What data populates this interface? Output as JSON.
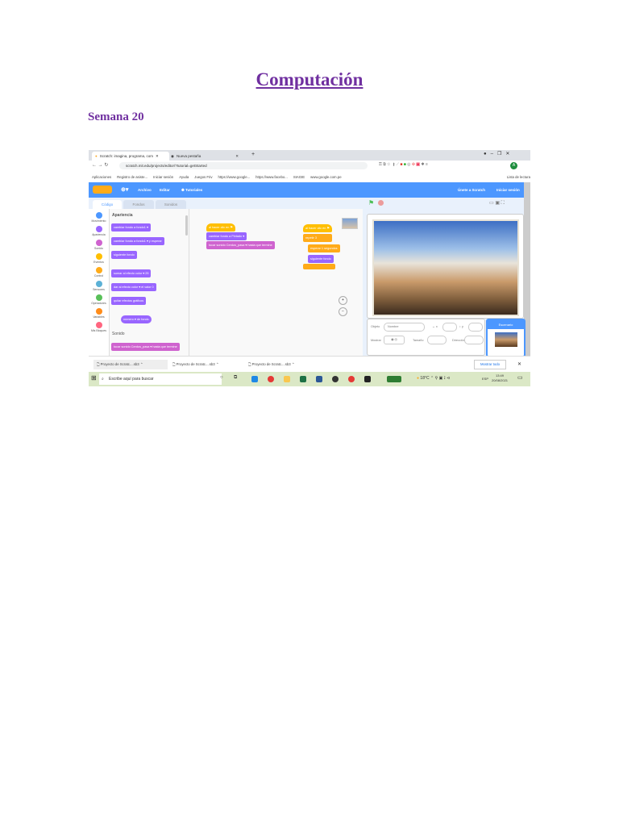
{
  "document": {
    "title": "Computación",
    "week": "Semana 20"
  },
  "browser": {
    "tabs": [
      {
        "label": "Scratch: imagina, programa, com"
      },
      {
        "label": "Nueva pestaña"
      }
    ],
    "url": "scratch.mit.edu/projects/editor/?tutorial=getStarted",
    "bookmarks": [
      "Aplicaciones",
      "Registro de asiste...",
      "Iniciar sesión",
      "Ayuda",
      "Juegos Friv",
      "https://www.google...",
      "https://www.facebo...",
      "SIAGIE",
      "www.google.com.pe"
    ],
    "reading_list": "Lista de lectura",
    "profile_initial": "A"
  },
  "scratch": {
    "menu": {
      "file": "Archivo",
      "edit": "Editar",
      "tutorials": "Tutoriales",
      "join": "Únete a Scratch",
      "signin": "Iniciar sesión"
    },
    "tabs": {
      "code": "Código",
      "backdrops": "Fondos",
      "sounds": "Sonidos"
    },
    "categories": [
      {
        "label": "Movimiento",
        "color": "#4c97ff"
      },
      {
        "label": "Apariencia",
        "color": "#9966ff"
      },
      {
        "label": "Sonido",
        "color": "#cf63cf"
      },
      {
        "label": "Eventos",
        "color": "#ffbf00"
      },
      {
        "label": "Control",
        "color": "#ffab19"
      },
      {
        "label": "Sensores",
        "color": "#5cb1d6"
      },
      {
        "label": "Operadores",
        "color": "#59c059"
      },
      {
        "label": "Variables",
        "color": "#ff8c1a"
      },
      {
        "label": "Mis Bloques",
        "color": "#ff6680"
      }
    ],
    "palette": {
      "section_looks": "Apariencia",
      "section_sound": "Sonido",
      "blocks": [
        "cambiar fondo a fondo1 ▾",
        "cambiar fondo a fondo1 ▾ y esperar",
        "siguiente fondo",
        "sumar al efecto color ▾ 25",
        "dar al efecto color ▾ el valor 0",
        "quitar efectos gráficos",
        "número ▾ de fondo",
        "tocar sonido Cerdos_pasa ▾ hasta que termine"
      ]
    },
    "script1": [
      "al hacer clic en ⚑",
      "cambiar fondo a Pintado ▾",
      "tocar sonido Cerdos_pasa ▾ hasta que termine"
    ],
    "script2": [
      "al hacer clic en ⚑",
      "repetir 3",
      "esperar 1 segundos",
      "siguiente fondo"
    ],
    "sprite": {
      "label": "Objeto",
      "name": "Nombre",
      "x_label": "x",
      "y_label": "y",
      "show": "Mostrar",
      "size": "Tamaño",
      "direction": "Dirección"
    },
    "stage_label": "Escenario"
  },
  "downloads": {
    "items": [
      "Proyecto de Scratc....sb3",
      "Proyecto de Scratc....sb3",
      "Proyecto de Scratc....sb3"
    ],
    "show_all": "Mostrar todo"
  },
  "taskbar": {
    "search": "Escribe aquí para buscar",
    "weather": "18°C",
    "lang": "ESP",
    "time": "13:49",
    "date": "20/08/2021"
  }
}
